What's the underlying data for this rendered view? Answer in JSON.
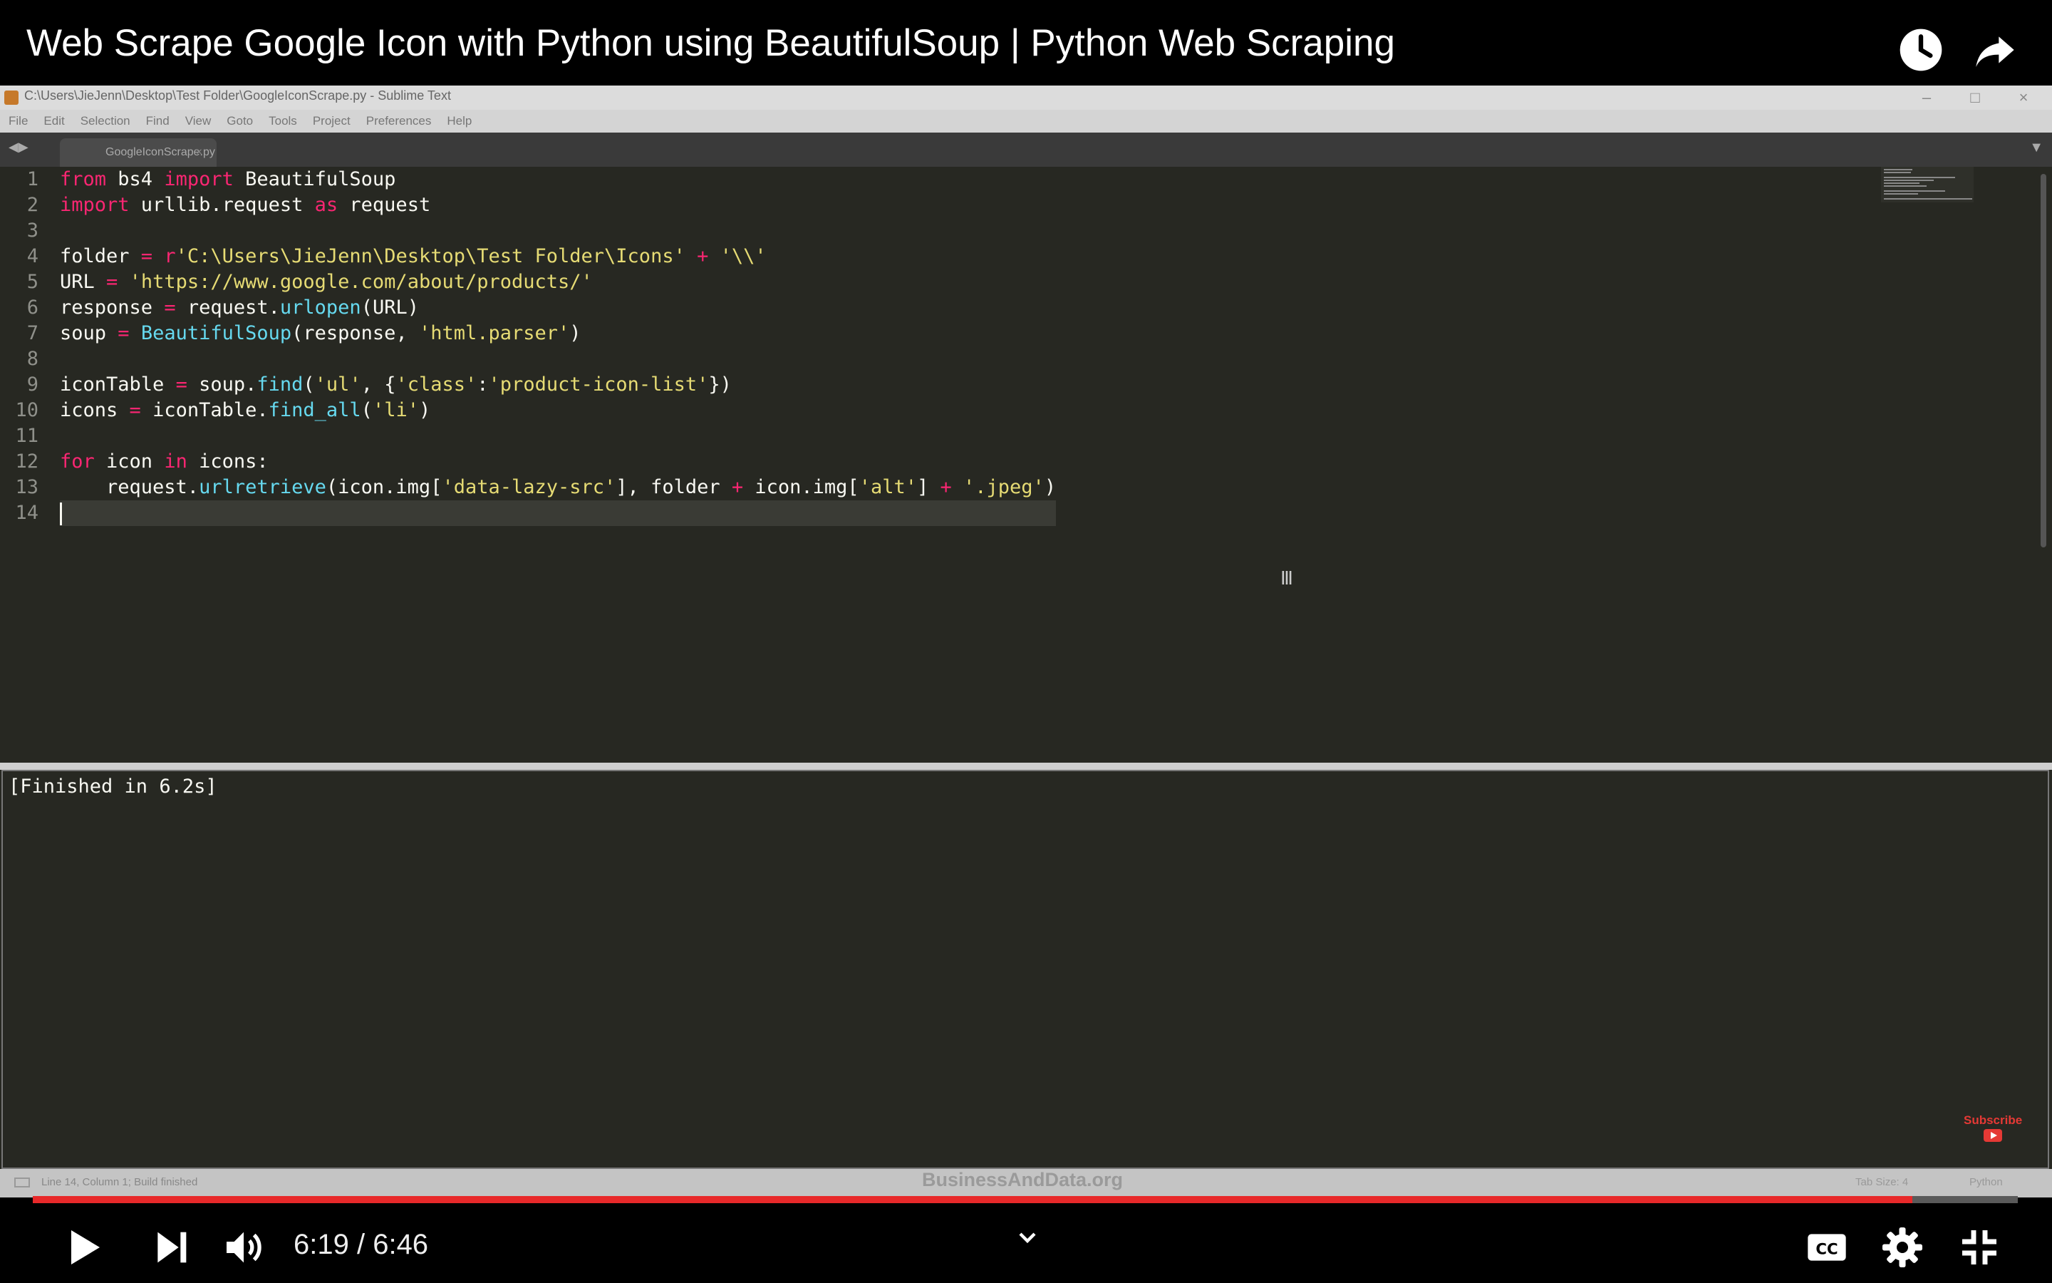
{
  "video": {
    "title": "Web Scrape Google Icon with Python using BeautifulSoup | Python Web Scraping",
    "time_current": "6:19",
    "time_separator": " / ",
    "time_total": "6:46",
    "progress_fraction": 0.9467
  },
  "editor": {
    "window_title": "C:\\Users\\JieJenn\\Desktop\\Test Folder\\GoogleIconScrape.py - Sublime Text",
    "window_buttons": [
      "–",
      "□",
      "×"
    ],
    "menu": [
      "File",
      "Edit",
      "Selection",
      "Find",
      "View",
      "Goto",
      "Tools",
      "Project",
      "Preferences",
      "Help"
    ],
    "tab_name": "GoogleIconScrape.py",
    "line_numbers": [
      "1",
      "2",
      "3",
      "4",
      "5",
      "6",
      "7",
      "8",
      "9",
      "10",
      "11",
      "12",
      "13",
      "14"
    ],
    "code_lines": [
      [
        {
          "t": "from",
          "c": "kw"
        },
        {
          "t": " bs4 "
        },
        {
          "t": "import",
          "c": "kw"
        },
        {
          "t": " BeautifulSoup"
        }
      ],
      [
        {
          "t": "import",
          "c": "kw"
        },
        {
          "t": " urllib.request "
        },
        {
          "t": "as",
          "c": "kw"
        },
        {
          "t": " request"
        }
      ],
      [],
      [
        {
          "t": "folder "
        },
        {
          "t": "=",
          "c": "kw"
        },
        {
          "t": " "
        },
        {
          "t": "r",
          "c": "kw"
        },
        {
          "t": "'C:\\Users\\JieJenn\\Desktop\\Test Folder\\Icons'",
          "c": "str"
        },
        {
          "t": " "
        },
        {
          "t": "+",
          "c": "kw"
        },
        {
          "t": " "
        },
        {
          "t": "'\\\\'",
          "c": "str"
        }
      ],
      [
        {
          "t": "URL "
        },
        {
          "t": "=",
          "c": "kw"
        },
        {
          "t": " "
        },
        {
          "t": "'https://www.google.com/about/products/'",
          "c": "str"
        }
      ],
      [
        {
          "t": "response "
        },
        {
          "t": "=",
          "c": "kw"
        },
        {
          "t": " request."
        },
        {
          "t": "urlopen",
          "c": "fn"
        },
        {
          "t": "(URL)"
        }
      ],
      [
        {
          "t": "soup "
        },
        {
          "t": "=",
          "c": "kw"
        },
        {
          "t": " "
        },
        {
          "t": "BeautifulSoup",
          "c": "fn"
        },
        {
          "t": "(response, "
        },
        {
          "t": "'html.parser'",
          "c": "str"
        },
        {
          "t": ")"
        }
      ],
      [],
      [
        {
          "t": "iconTable "
        },
        {
          "t": "=",
          "c": "kw"
        },
        {
          "t": " soup."
        },
        {
          "t": "find",
          "c": "fn"
        },
        {
          "t": "("
        },
        {
          "t": "'ul'",
          "c": "str"
        },
        {
          "t": ", {"
        },
        {
          "t": "'class'",
          "c": "str"
        },
        {
          "t": ":"
        },
        {
          "t": "'product-icon-list'",
          "c": "str"
        },
        {
          "t": "})"
        }
      ],
      [
        {
          "t": "icons "
        },
        {
          "t": "=",
          "c": "kw"
        },
        {
          "t": " iconTable."
        },
        {
          "t": "find_all",
          "c": "fn"
        },
        {
          "t": "("
        },
        {
          "t": "'li'",
          "c": "str"
        },
        {
          "t": ")"
        }
      ],
      [],
      [
        {
          "t": "for",
          "c": "kw"
        },
        {
          "t": " icon "
        },
        {
          "t": "in",
          "c": "kw"
        },
        {
          "t": " icons:"
        }
      ],
      [
        {
          "t": "    request."
        },
        {
          "t": "urlretrieve",
          "c": "fn"
        },
        {
          "t": "(icon.img["
        },
        {
          "t": "'data-lazy-src'",
          "c": "str"
        },
        {
          "t": "], folder "
        },
        {
          "t": "+",
          "c": "kw"
        },
        {
          "t": " icon.img["
        },
        {
          "t": "'alt'",
          "c": "str"
        },
        {
          "t": "] "
        },
        {
          "t": "+",
          "c": "kw"
        },
        {
          "t": " "
        },
        {
          "t": "'.jpeg'",
          "c": "str"
        },
        {
          "t": ")"
        }
      ],
      []
    ],
    "cursor_line": 14,
    "output_text": "[Finished in 6.2s]",
    "subscribe_label": "Subscribe",
    "watermark": "BusinessAndData.org",
    "status_text": "Line 14, Column 1; Build finished",
    "status_tab_size": "Tab Size: 4",
    "status_syntax": "Python"
  },
  "colors": {
    "accent_progress": "#e8292a",
    "keyword": "#f92672",
    "string": "#e6db74",
    "function": "#66d9ef",
    "background": "#272822"
  }
}
